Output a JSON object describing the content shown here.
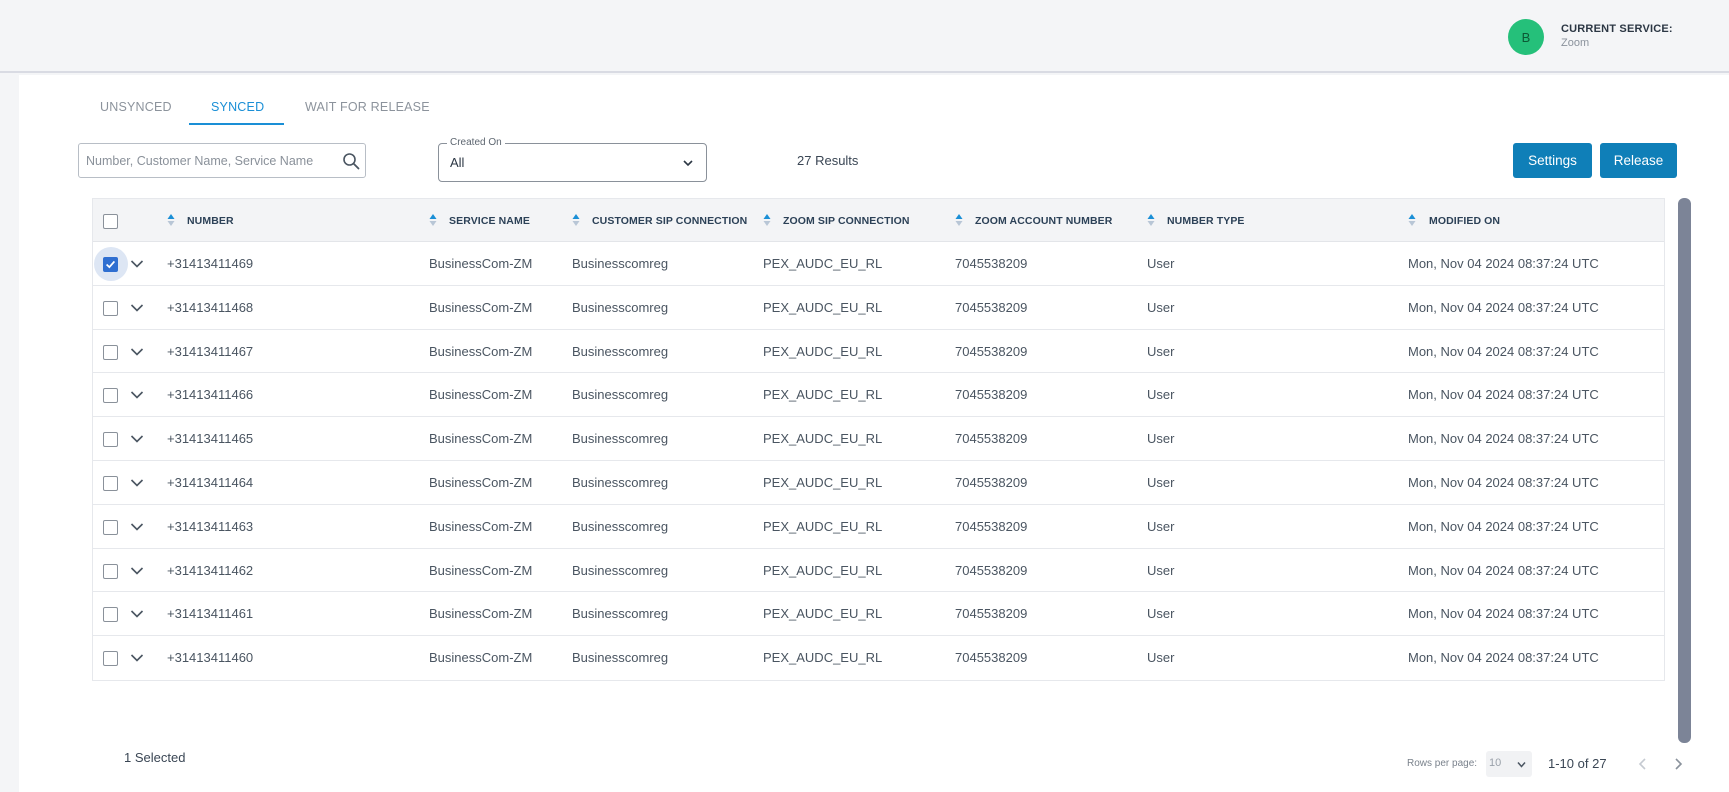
{
  "header": {
    "avatar_initial": "B",
    "current_service_label": "CURRENT SERVICE:",
    "current_service_value": "Zoom"
  },
  "tabs": [
    {
      "label": "UNSYNCED",
      "active": false
    },
    {
      "label": "SYNCED",
      "active": true
    },
    {
      "label": "WAIT FOR RELEASE",
      "active": false
    }
  ],
  "search": {
    "placeholder": "Number, Customer Name, Service Name",
    "value": ""
  },
  "created_on": {
    "label": "Created On",
    "value": "All"
  },
  "results_text": "27 Results",
  "buttons": {
    "settings": "Settings",
    "release": "Release"
  },
  "table": {
    "columns": [
      "NUMBER",
      "SERVICE NAME",
      "CUSTOMER SIP CONNECTION",
      "ZOOM SIP CONNECTION",
      "ZOOM ACCOUNT NUMBER",
      "NUMBER TYPE",
      "MODIFIED ON"
    ],
    "rows": [
      {
        "checked": true,
        "number": "+31413411469",
        "service": "BusinessCom-ZM",
        "customer_sip": "Businesscomreg",
        "zoom_sip": "PEX_AUDC_EU_RL",
        "account": "7045538209",
        "type": "User",
        "modified": "Mon, Nov 04 2024 08:37:24 UTC"
      },
      {
        "checked": false,
        "number": "+31413411468",
        "service": "BusinessCom-ZM",
        "customer_sip": "Businesscomreg",
        "zoom_sip": "PEX_AUDC_EU_RL",
        "account": "7045538209",
        "type": "User",
        "modified": "Mon, Nov 04 2024 08:37:24 UTC"
      },
      {
        "checked": false,
        "number": "+31413411467",
        "service": "BusinessCom-ZM",
        "customer_sip": "Businesscomreg",
        "zoom_sip": "PEX_AUDC_EU_RL",
        "account": "7045538209",
        "type": "User",
        "modified": "Mon, Nov 04 2024 08:37:24 UTC"
      },
      {
        "checked": false,
        "number": "+31413411466",
        "service": "BusinessCom-ZM",
        "customer_sip": "Businesscomreg",
        "zoom_sip": "PEX_AUDC_EU_RL",
        "account": "7045538209",
        "type": "User",
        "modified": "Mon, Nov 04 2024 08:37:24 UTC"
      },
      {
        "checked": false,
        "number": "+31413411465",
        "service": "BusinessCom-ZM",
        "customer_sip": "Businesscomreg",
        "zoom_sip": "PEX_AUDC_EU_RL",
        "account": "7045538209",
        "type": "User",
        "modified": "Mon, Nov 04 2024 08:37:24 UTC"
      },
      {
        "checked": false,
        "number": "+31413411464",
        "service": "BusinessCom-ZM",
        "customer_sip": "Businesscomreg",
        "zoom_sip": "PEX_AUDC_EU_RL",
        "account": "7045538209",
        "type": "User",
        "modified": "Mon, Nov 04 2024 08:37:24 UTC"
      },
      {
        "checked": false,
        "number": "+31413411463",
        "service": "BusinessCom-ZM",
        "customer_sip": "Businesscomreg",
        "zoom_sip": "PEX_AUDC_EU_RL",
        "account": "7045538209",
        "type": "User",
        "modified": "Mon, Nov 04 2024 08:37:24 UTC"
      },
      {
        "checked": false,
        "number": "+31413411462",
        "service": "BusinessCom-ZM",
        "customer_sip": "Businesscomreg",
        "zoom_sip": "PEX_AUDC_EU_RL",
        "account": "7045538209",
        "type": "User",
        "modified": "Mon, Nov 04 2024 08:37:24 UTC"
      },
      {
        "checked": false,
        "number": "+31413411461",
        "service": "BusinessCom-ZM",
        "customer_sip": "Businesscomreg",
        "zoom_sip": "PEX_AUDC_EU_RL",
        "account": "7045538209",
        "type": "User",
        "modified": "Mon, Nov 04 2024 08:37:24 UTC"
      },
      {
        "checked": false,
        "number": "+31413411460",
        "service": "BusinessCom-ZM",
        "customer_sip": "Businesscomreg",
        "zoom_sip": "PEX_AUDC_EU_RL",
        "account": "7045538209",
        "type": "User",
        "modified": "Mon, Nov 04 2024 08:37:24 UTC"
      }
    ]
  },
  "footer": {
    "selected_text": "1  Selected",
    "rows_per_page_label": "Rows per page:",
    "rows_per_page_value": "10",
    "range_text": "1-10 of 27"
  },
  "colors": {
    "accent": "#1a8fd6",
    "button": "#0f7fb8",
    "avatar": "#25c07a",
    "checkbox_checked": "#2f6fd1"
  },
  "icons": [
    "search-icon",
    "chevron-down-icon",
    "sort-icon",
    "checkmark-icon",
    "chevron-left-icon",
    "chevron-right-icon"
  ]
}
